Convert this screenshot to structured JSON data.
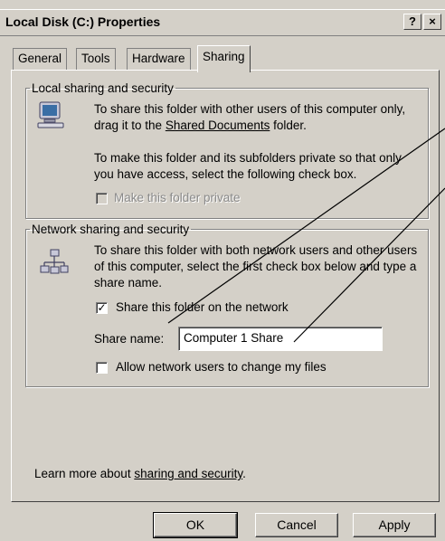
{
  "window": {
    "title": "Local Disk (C:) Properties",
    "help_label": "?",
    "close_label": "×"
  },
  "tabs": [
    {
      "label": "General",
      "active": false
    },
    {
      "label": "Tools",
      "active": false
    },
    {
      "label": "Hardware",
      "active": false
    },
    {
      "label": "Sharing",
      "active": true
    }
  ],
  "local_group": {
    "legend": "Local sharing and security",
    "text1_pre": "To share this folder with other users of this computer only, drag it to the ",
    "text1_link": "Shared Documents",
    "text1_post": " folder.",
    "text2": "To make this folder and its subfolders private so that only you have access, select the following check box.",
    "private_checkbox": {
      "label": "Make this folder private",
      "checked": false,
      "enabled": false
    }
  },
  "network_group": {
    "legend": "Network sharing and security",
    "text": "To share this folder with both network users and other users of this computer, select the first check box below and type a share name.",
    "share_checkbox": {
      "label": "Share this folder on the network",
      "checked": true
    },
    "share_name_label": "Share name:",
    "share_name_value": "Computer 1 Share",
    "allow_checkbox": {
      "label": "Allow network users to change my files",
      "checked": false
    }
  },
  "footer": {
    "learn_pre": "Learn more about ",
    "learn_link": "sharing and security",
    "learn_post": "."
  },
  "buttons": {
    "ok": "OK",
    "cancel": "Cancel",
    "apply": "Apply"
  },
  "check_mark": "✓"
}
